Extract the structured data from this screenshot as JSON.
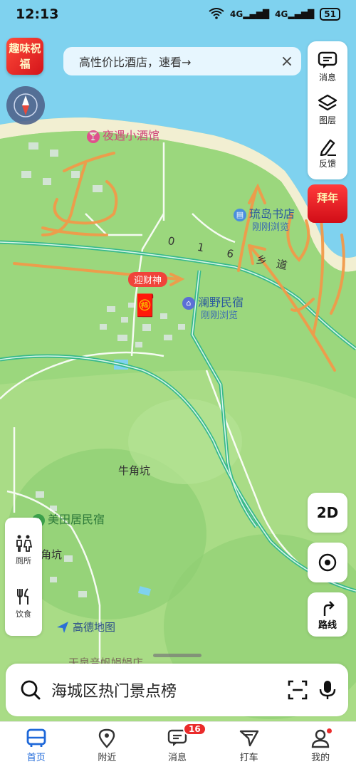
{
  "status_bar": {
    "time": "12:13",
    "signal_1": "4G",
    "signal_2": "4G",
    "battery": "51"
  },
  "promo_badge": {
    "text": "趣味祝福"
  },
  "notice": {
    "text": "高性价比酒店，速看→",
    "close": "×"
  },
  "right_panel": [
    {
      "label": "消息",
      "icon": "message-icon"
    },
    {
      "label": "图层",
      "icon": "layers-icon"
    },
    {
      "label": "反馈",
      "icon": "feedback-icon"
    }
  ],
  "new_year_button": {
    "text": "拜年"
  },
  "map_labels": {
    "bar": "夜遇小酒馆",
    "bookstore": "琉岛书店",
    "bookstore_sub": "刚刚浏览",
    "road": "0 1 6 乡道",
    "guesthouse": "澜野民宿",
    "guesthouse_sub": "刚刚浏览",
    "red_tag": "迎财神",
    "village_1": "牛角坑",
    "village_2": "角坑",
    "meitian": "美田居民宿",
    "amap": "高德地图",
    "bottom_partial": "天泉音帆娟娟店"
  },
  "left_panel": [
    {
      "label": "厕所",
      "icon": "toilet-icon"
    },
    {
      "label": "饮食",
      "icon": "food-icon"
    }
  ],
  "map_buttons": {
    "mode": "2D",
    "route": "路线"
  },
  "search": {
    "placeholder": "海城区热门景点榜"
  },
  "tabbar": [
    {
      "label": "首页",
      "icon": "home-bus-icon",
      "active": true
    },
    {
      "label": "附近",
      "icon": "location-pin-icon"
    },
    {
      "label": "消息",
      "icon": "message-icon",
      "count": "16"
    },
    {
      "label": "打车",
      "icon": "taxi-icon"
    },
    {
      "label": "我的",
      "icon": "profile-icon"
    }
  ],
  "colors": {
    "accent": "#1e68d9",
    "sea": "#7fd2ef",
    "land": "#a9dc86",
    "road": "#37b88b",
    "drawing": "#f19a4a"
  }
}
